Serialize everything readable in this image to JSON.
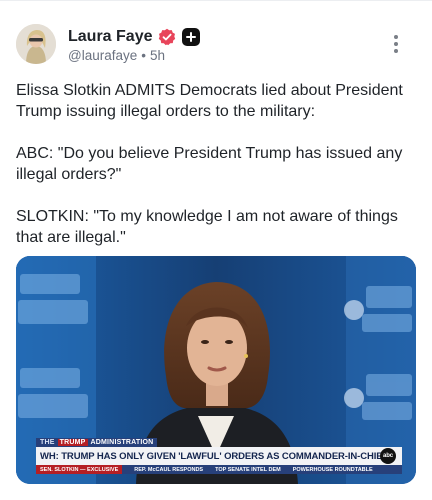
{
  "post": {
    "author_name": "Laura Faye",
    "handle": "@laurafaye",
    "separator": "•",
    "time": "5h",
    "paragraphs": [
      "Elissa Slotkin ADMITS Democrats lied about President Trump issuing illegal orders to the military:",
      "ABC: \"Do you believe President Trump has issued any illegal orders?\"",
      "SLOTKIN: \"To my knowledge I am not aware of things that are illegal.\""
    ]
  },
  "icons": {
    "verified": "verified-badge-icon",
    "plus": "plus-badge-icon",
    "more": "more-vertical-icon"
  },
  "media": {
    "lower_third": {
      "tag_prefix": "THE",
      "tag_highlight": "TRUMP",
      "tag_rest": "ADMINISTRATION",
      "headline": "WH: TRUMP HAS ONLY GIVEN 'LAWFUL' ORDERS AS COMMANDER-IN-CHIEF",
      "network": "abc",
      "ticker": [
        "SEN. SLOTKIN — EXCLUSIVE",
        "REP. McCAUL RESPONDS",
        "TOP SENATE INTEL DEM",
        "POWERHOUSE ROUNDTABLE"
      ]
    }
  },
  "colors": {
    "accent_verified": "#e8445a",
    "studio_blue": "#1a4d8c",
    "chyron_navy": "#27407a",
    "chyron_red": "#b51f24"
  }
}
